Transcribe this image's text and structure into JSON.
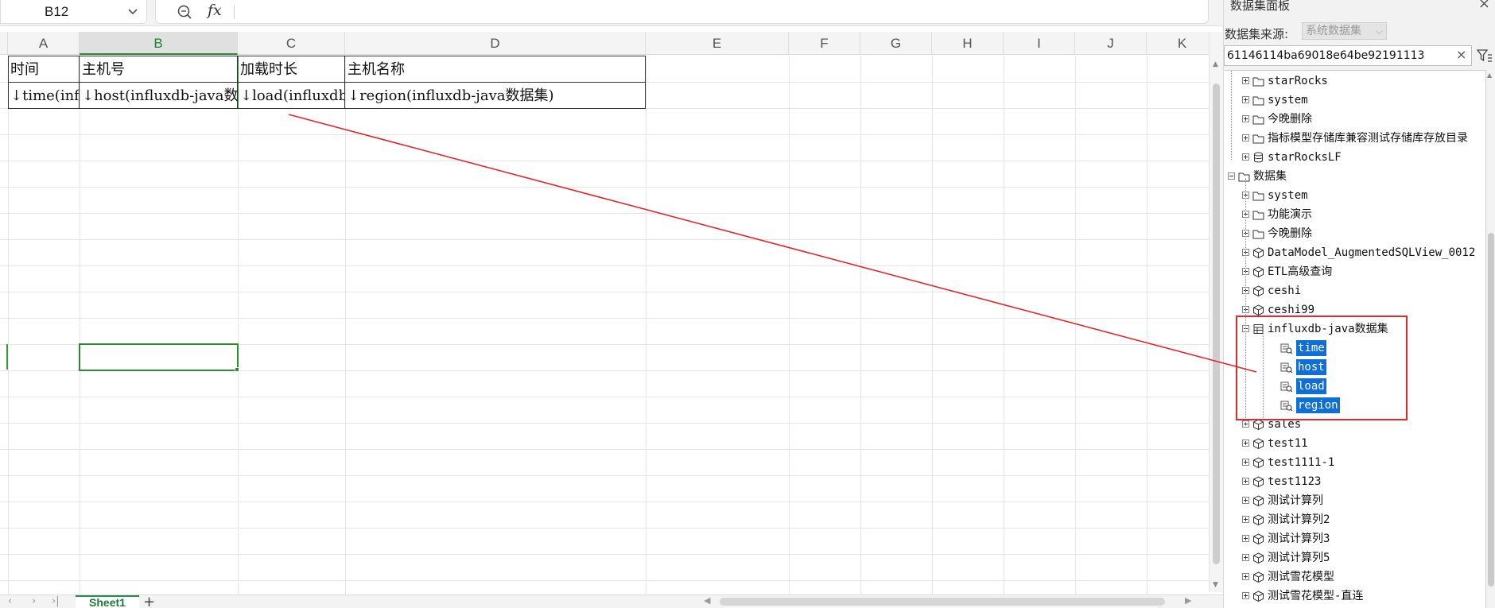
{
  "formula_bar": {
    "name_box": "B12",
    "formula_value": ""
  },
  "grid": {
    "columns": [
      "A",
      "B",
      "C",
      "D",
      "E",
      "F",
      "G",
      "H",
      "I",
      "J",
      "K"
    ],
    "active_column": "B",
    "selected_cell": "B12",
    "table": {
      "headers": [
        "时间",
        "主机号",
        "加载时长",
        "主机名称"
      ],
      "row2": [
        "↓time(influxdb-java数据集)",
        "↓host(influxdb-java数据集)",
        "↓load(influxdb-java数据集)",
        "↓region(influxdb-java数据集)"
      ]
    }
  },
  "sheets": {
    "tabs": [
      "Sheet1"
    ],
    "add_label": "+"
  },
  "panel": {
    "title": "数据集面板",
    "source_label": "数据集来源:",
    "source_value": "系统数据集",
    "search_value": "61146114ba69018e64be92191113",
    "tree": [
      {
        "label": "starRocks",
        "icon": "folder-icon"
      },
      {
        "label": "system",
        "icon": "folder-icon"
      },
      {
        "label": "今晚删除",
        "icon": "folder-icon"
      },
      {
        "label": "指标模型存储库兼容测试存储库存放目录",
        "icon": "folder-icon"
      },
      {
        "label": "starRocksLF",
        "icon": "database-icon"
      },
      {
        "label": "数据集",
        "icon": "folder-icon"
      },
      {
        "label": "system",
        "icon": "folder-icon"
      },
      {
        "label": "功能演示",
        "icon": "folder-icon"
      },
      {
        "label": "今晚删除",
        "icon": "folder-icon"
      },
      {
        "label": "DataModel_AugmentedSQLView_0012",
        "icon": "cube-icon"
      },
      {
        "label": "ETL高级查询",
        "icon": "cube-icon"
      },
      {
        "label": "ceshi",
        "icon": "cube-icon"
      },
      {
        "label": "ceshi99",
        "icon": "cube-icon"
      },
      {
        "label": "influxdb-java数据集",
        "icon": "dataset-icon"
      },
      {
        "label": "time",
        "icon": "field-icon"
      },
      {
        "label": "host",
        "icon": "field-icon"
      },
      {
        "label": "load",
        "icon": "field-icon"
      },
      {
        "label": "region",
        "icon": "field-icon"
      },
      {
        "label": "sales",
        "icon": "cube-icon"
      },
      {
        "label": "test11",
        "icon": "cube-icon"
      },
      {
        "label": "test1111-1",
        "icon": "cube-icon"
      },
      {
        "label": "test1123",
        "icon": "cube-icon"
      },
      {
        "label": "测试计算列",
        "icon": "cube-icon"
      },
      {
        "label": "测试计算列2",
        "icon": "cube-icon"
      },
      {
        "label": "测试计算列3",
        "icon": "cube-icon"
      },
      {
        "label": "测试计算列5",
        "icon": "cube-icon"
      },
      {
        "label": "测试雪花模型",
        "icon": "cube-icon"
      },
      {
        "label": "测试雪花模型-直连",
        "icon": "cube-icon"
      }
    ]
  },
  "colors": {
    "accent_green": "#2e8b2e",
    "selection_blue": "#0f6fd6",
    "annotation_red": "#e0282f"
  }
}
